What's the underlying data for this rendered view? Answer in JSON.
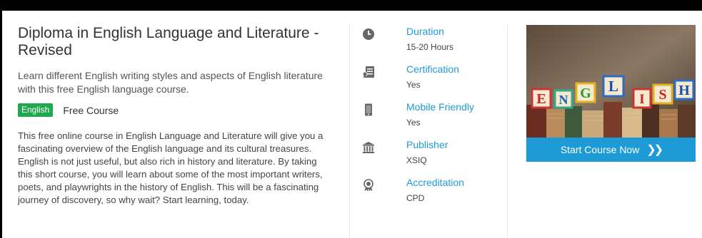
{
  "course": {
    "title": "Diploma in English Language and Literature - Revised",
    "subtitle": "Learn different English writing styles and aspects of English literature with this free English language course.",
    "category_badge": "English",
    "price_label": "Free Course",
    "description": "This free online course in English Language and Literature will give you a fascinating overview of the English language and its cultural treasures. English is not just useful, but also rich in history and literature. By taking this short course, you will learn about some of the most important writers, poets, and playwrights in the history of English. This will be a fascinating journey of discovery, so why wait? Start learning, today."
  },
  "info": {
    "duration": {
      "label": "Duration",
      "value": "15-20 Hours",
      "icon": "clock-icon"
    },
    "certification": {
      "label": "Certification",
      "value": "Yes",
      "icon": "certificate-icon"
    },
    "mobile": {
      "label": "Mobile Friendly",
      "value": "Yes",
      "icon": "mobile-icon"
    },
    "publisher": {
      "label": "Publisher",
      "value": "XSIQ",
      "icon": "institution-icon"
    },
    "accreditation": {
      "label": "Accreditation",
      "value": "CPD",
      "icon": "award-icon"
    }
  },
  "hero_image": {
    "letters": [
      "E",
      "N",
      "G",
      "L",
      "I",
      "S",
      "H"
    ]
  },
  "cta": {
    "label": "Start Course Now",
    "icon": "double-chevron-right-icon"
  },
  "colors": {
    "accent": "#1e9bd7",
    "badge": "#1fa84f",
    "icon_gray": "#666666"
  }
}
